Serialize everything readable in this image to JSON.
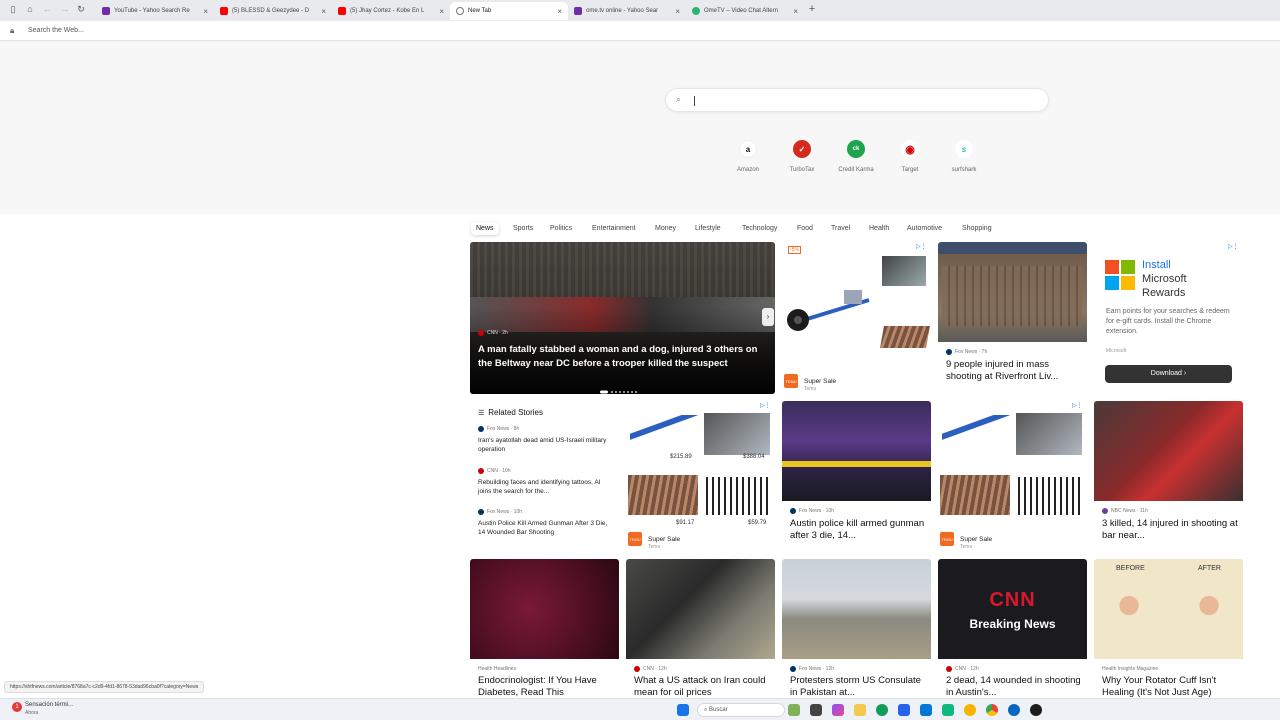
{
  "tabs": [
    {
      "label": "YouTube - Yahoo Search Re",
      "color": "#6f2da8"
    },
    {
      "label": "(5) BLESSD & Geezydee - D",
      "color": "#ff0000"
    },
    {
      "label": "(5) Jhay Cortez - Kobe En L",
      "color": "#ff0000"
    },
    {
      "label": "New Tab",
      "color": "#777777"
    },
    {
      "label": "ome.tv online - Yahoo Sear",
      "color": "#6f2da8"
    },
    {
      "label": "OmeTV – Video Chat Altern",
      "color": "#2bb673"
    }
  ],
  "address": {
    "placeholder": "Search the Web..."
  },
  "quick_links": [
    {
      "label": "Amazon",
      "glyph": "a",
      "color": "#ffffff",
      "fg": "#111"
    },
    {
      "label": "TurboTax",
      "glyph": "✓",
      "color": "#d52b1e",
      "fg": "#fff"
    },
    {
      "label": "Credit Karma",
      "glyph": "ck",
      "color": "#1ea54c",
      "fg": "#fff"
    },
    {
      "label": "Target",
      "glyph": "◉",
      "color": "#ffffff",
      "fg": "#cc0000"
    },
    {
      "label": "surfshark",
      "glyph": "s",
      "color": "#ffffff",
      "fg": "#1ec0a8"
    }
  ],
  "categories": [
    "News",
    "Sports",
    "Politics",
    "Entertainment",
    "Money",
    "Lifestyle",
    "Technology",
    "Food",
    "Travel",
    "Health",
    "Automotive",
    "Shopping"
  ],
  "hero": {
    "source": "CNN · 2h",
    "title": "A man fatally stabbed a woman and a dog, injured 3 others on the Beltway near DC before a trooper killed the suspect"
  },
  "ad1": {
    "badge": "-5%",
    "label": "Super Sale",
    "sub": "Temu"
  },
  "story_mass": {
    "source": "Fox News · 7h",
    "title": "9 people injured in mass shooting at Riverfront Liv..."
  },
  "ms_ad": {
    "title": "Install Microsoft Rewards",
    "line1": "Install",
    "line2": "Microsoft",
    "line3": "Rewards",
    "desc": "Earn points for your searches & redeem for e-gift cards. Install the Chrome extension.",
    "brand": "Microsoft",
    "button": "Download"
  },
  "related": {
    "header": "Related Stories",
    "items": [
      {
        "source": "Fox News · 8h",
        "title": "Iran's ayatollah dead amid US-Israeli military operation"
      },
      {
        "source": "CNN · 10h",
        "title": "Rebuilding faces and identifying tattoos, AI joins the search for the..."
      },
      {
        "source": "Fox News · 10h",
        "title": "Austin Police Kill Armed Gunman After 3 Die, 14 Wounded Bar Shooting"
      }
    ]
  },
  "ad2": {
    "price1": "$215.89",
    "price2": "$388.04",
    "price3": "$91.17",
    "price4": "$59.79",
    "label": "Super Sale",
    "sub": "Temu"
  },
  "story_austin": {
    "source": "Fox News · 10h",
    "title": "Austin police kill armed gunman after 3 die, 14..."
  },
  "ad3": {
    "label": "Super Sale",
    "sub": "Temu"
  },
  "story_bar": {
    "source": "NBC News · 11h",
    "title": "3 killed, 14 injured in shooting at bar near..."
  },
  "row3": [
    {
      "source": "Health Headlines",
      "title": "Endocrinologist: If You Have Diabetes, Read This"
    },
    {
      "source": "CNN · 12h",
      "title": "What a US attack on Iran could mean for oil prices"
    },
    {
      "source": "Fox News · 12h",
      "title": "Protesters storm US Consulate in Pakistan at..."
    },
    {
      "source": "CNN · 12h",
      "title": "2 dead, 14 wounded in shooting in Austin's..."
    },
    {
      "source": "Health Insights Magazine",
      "title": "Why Your Rotator Cuff Isn't Healing (It's Not Just Age)"
    }
  ],
  "cnn_card": {
    "logo": "CNN",
    "text": "Breaking News"
  },
  "rotator": {
    "before": "BEFORE",
    "after": "AFTER"
  },
  "status_url": "https://shtfnews.com/article/8768a7c-c2d9-4fd1-8678-53dad96cba0f?category=News",
  "taskbar": {
    "search": "Buscar",
    "notification": "Sensación térmi...",
    "notification_sub": "Ahora"
  }
}
